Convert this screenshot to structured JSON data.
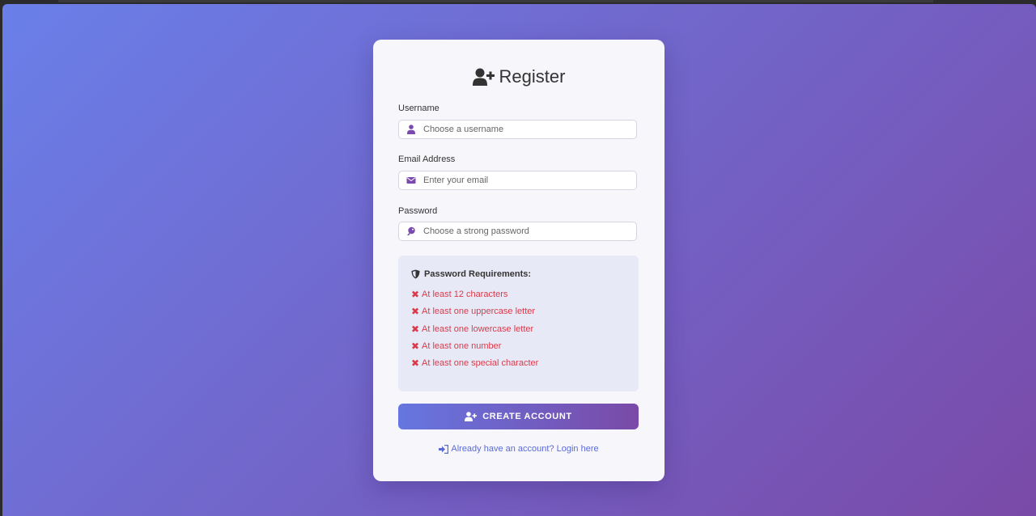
{
  "colors": {
    "bg_start": "#6a7fe9",
    "bg_end": "#7a4aa8",
    "button_start": "#6676e0",
    "button_end": "#7a4aa8",
    "accent": "#7b4ab0",
    "error": "#d93a4a",
    "link": "#5b6bd6"
  },
  "page": {
    "title": "Register",
    "title_icon": "user-plus-icon"
  },
  "form": {
    "username": {
      "label": "Username",
      "placeholder": "Choose a username",
      "value": "",
      "icon": "user-icon"
    },
    "email": {
      "label": "Email Address",
      "placeholder": "Enter your email",
      "value": "",
      "icon": "envelope-icon"
    },
    "password": {
      "label": "Password",
      "placeholder": "Choose a strong password",
      "value": "",
      "icon": "key-icon"
    }
  },
  "requirements": {
    "title": "Password Requirements:",
    "icon": "shield-icon",
    "items": [
      {
        "text": "At least 12 characters",
        "mark": "✖"
      },
      {
        "text": "At least one uppercase letter",
        "mark": "✖"
      },
      {
        "text": "At least one lowercase letter",
        "mark": "✖"
      },
      {
        "text": "At least one number",
        "mark": "✖"
      },
      {
        "text": "At least one special character",
        "mark": "✖"
      }
    ]
  },
  "submit": {
    "label": "CREATE ACCOUNT",
    "icon": "user-plus-icon"
  },
  "login_link": {
    "label": "Already have an account? Login here",
    "icon": "sign-in-icon"
  }
}
